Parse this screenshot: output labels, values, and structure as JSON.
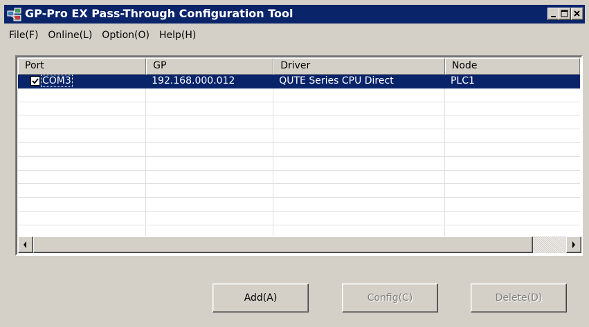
{
  "window": {
    "title": "GP-Pro EX Pass-Through Configuration Tool"
  },
  "menu": [
    {
      "label": "File(F)"
    },
    {
      "label": "Online(L)"
    },
    {
      "label": "Option(O)"
    },
    {
      "label": "Help(H)"
    }
  ],
  "table": {
    "columns": [
      "Port",
      "GP",
      "Driver",
      "Node"
    ],
    "rows": [
      {
        "checked": true,
        "port": "COM3",
        "gp": "192.168.000.012",
        "driver": "QUTE Series CPU Direct",
        "node": "PLC1"
      }
    ],
    "empty_rows": 11
  },
  "buttons": {
    "add": "Add(A)",
    "config": "Config(C)",
    "delete": "Delete(D)"
  },
  "colors": {
    "titlebar": "#0a246a",
    "selection": "#0a246a",
    "face": "#d4d0c8"
  }
}
